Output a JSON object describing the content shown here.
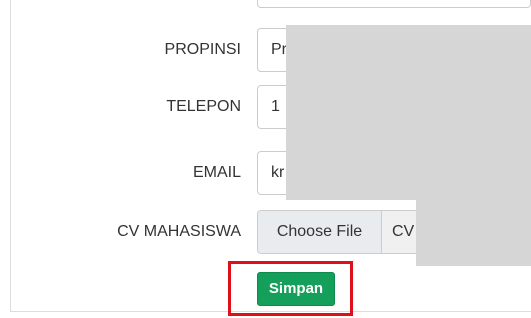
{
  "form": {
    "fields": [
      {
        "label": "PROPINSI",
        "value": "Pr"
      },
      {
        "label": "TELEPON",
        "value": "1"
      },
      {
        "label": "EMAIL",
        "value": "kr"
      }
    ],
    "cv": {
      "label": "CV MAHASISWA",
      "button": "Choose File",
      "file_text": "CV"
    },
    "submit_label": "Simpan"
  },
  "colors": {
    "submit_bg": "#14a05a",
    "highlight_border": "#e0101b",
    "redaction": "#d6d6d6"
  }
}
